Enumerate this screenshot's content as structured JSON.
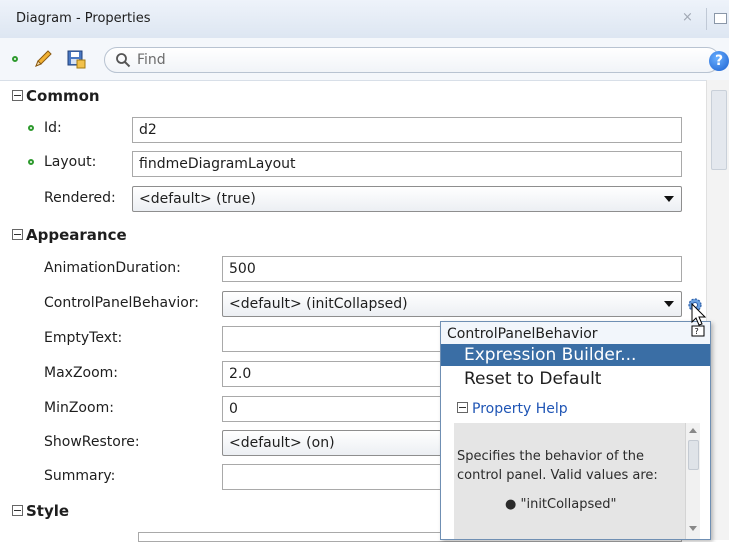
{
  "window": {
    "title": "Diagram - Properties",
    "close_glyph": "×"
  },
  "toolbar": {
    "find_placeholder": "Find",
    "help_glyph": "?"
  },
  "sections": {
    "common": "Common",
    "appearance": "Appearance",
    "style": "Style"
  },
  "common": {
    "id_label": "Id:",
    "id_value": "d2",
    "layout_label": "Layout:",
    "layout_value": "findmeDiagramLayout",
    "rendered_label": "Rendered:",
    "rendered_value": "<default> (true)"
  },
  "appearance": {
    "animation_label": "AnimationDuration:",
    "animation_value": "500",
    "cpb_label": "ControlPanelBehavior:",
    "cpb_value": "<default> (initCollapsed)",
    "empty_label": "EmptyText:",
    "empty_value": "",
    "maxzoom_label": "MaxZoom:",
    "maxzoom_value": "2.0",
    "minzoom_label": "MinZoom:",
    "minzoom_value": "0",
    "showrestore_label": "ShowRestore:",
    "showrestore_value": "<default> (on)",
    "summary_label": "Summary:",
    "summary_value": ""
  },
  "popup": {
    "title": "ControlPanelBehavior",
    "items": [
      "Expression Builder...",
      "Reset to Default"
    ],
    "help_header": "Property Help",
    "help_text": "Specifies the behavior of the control panel. Valid values are:",
    "help_cut": "\"initCollapsed\""
  },
  "colors": {
    "accent": "#3a6ea5",
    "required_dot": "#2e9a2e",
    "link": "#1f55b5"
  },
  "icons": [
    "required-dot-icon",
    "pencil-icon",
    "save-icon",
    "search-icon",
    "help-icon",
    "gear-icon",
    "cursor-icon",
    "collapse-icon"
  ]
}
